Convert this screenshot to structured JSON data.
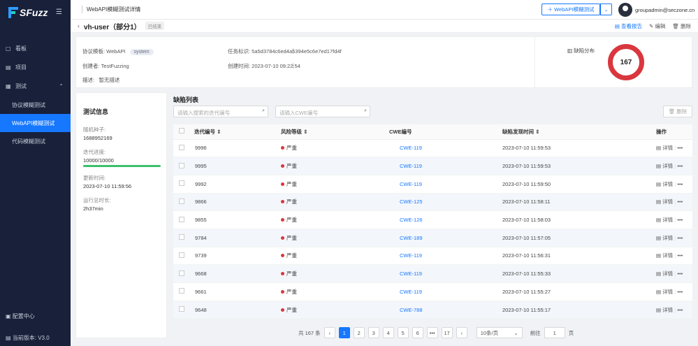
{
  "app": {
    "logo": "SFuzz"
  },
  "sidebar": {
    "items": [
      {
        "label": "看板",
        "icon": "dashboard-icon"
      },
      {
        "label": "项目",
        "icon": "project-icon"
      }
    ],
    "group": {
      "label": "测试",
      "icon": "test-icon"
    },
    "subs": [
      {
        "label": "协议模糊测试"
      },
      {
        "label": "WebAPI模糊测试",
        "active": true
      },
      {
        "label": "代码模糊测试"
      }
    ],
    "config": "配置中心",
    "version": "当前版本: V3.0"
  },
  "topbar": {
    "title": "WebAPI模糊测试详情",
    "new_btn": "WebAPI模糊测试",
    "user": "groupadmin@seczone.cn"
  },
  "header": {
    "title": "vh-user（部分1）",
    "status": "已结束",
    "view_report": "查看报告",
    "edit": "编辑",
    "delete": "删除"
  },
  "info": {
    "template_label": "协议模板: WebAPI",
    "template_tag": "system",
    "creator": "创建者: TestFuzzing",
    "desc_label": "描述:",
    "desc_value": "暂无描述",
    "task_id": "任务标识: 5a5d3784c6ed4a5394e5c6e7ed17fd4f",
    "create_time": "创建时间: 2023-07-10 09:22:54",
    "dist_title": "缺陷分布",
    "dist_total": "167"
  },
  "testinfo": {
    "title": "测试信息",
    "seed_label": "随机种子:",
    "seed": "1688952169",
    "progress_label": "迭代进度:",
    "progress": "10000/10000",
    "progress_fraction": 1.0,
    "update_label": "更新时间:",
    "update": "2023-07-10 11:59:56",
    "runtime_label": "运行总时长:",
    "runtime": "2h37min"
  },
  "list": {
    "title": "缺陷列表",
    "search1": "请输入搜索的迭代编号",
    "search2": "请输入CWE编号",
    "delete": "删除",
    "headers": [
      "迭代编号",
      "风险等级",
      "CWE编号",
      "缺陷发现时间",
      "操作"
    ],
    "detail": "详情",
    "rows": [
      {
        "id": "9996",
        "risk": "严重",
        "cwe": "CWE-119",
        "time": "2023-07-10 11:59:53"
      },
      {
        "id": "9995",
        "risk": "严重",
        "cwe": "CWE-119",
        "time": "2023-07-10 11:59:53"
      },
      {
        "id": "9992",
        "risk": "严重",
        "cwe": "CWE-119",
        "time": "2023-07-10 11:59:50"
      },
      {
        "id": "9866",
        "risk": "严重",
        "cwe": "CWE-125",
        "time": "2023-07-10 11:58:11"
      },
      {
        "id": "9855",
        "risk": "严重",
        "cwe": "CWE-126",
        "time": "2023-07-10 11:58:03"
      },
      {
        "id": "9784",
        "risk": "严重",
        "cwe": "CWE-189",
        "time": "2023-07-10 11:57:05"
      },
      {
        "id": "9739",
        "risk": "严重",
        "cwe": "CWE-119",
        "time": "2023-07-10 11:56:31"
      },
      {
        "id": "9668",
        "risk": "严重",
        "cwe": "CWE-119",
        "time": "2023-07-10 11:55:33"
      },
      {
        "id": "9661",
        "risk": "严重",
        "cwe": "CWE-119",
        "time": "2023-07-10 11:55:27"
      },
      {
        "id": "9648",
        "risk": "严重",
        "cwe": "CWE-788",
        "time": "2023-07-10 11:55:17"
      }
    ]
  },
  "pager": {
    "total": "共 167 条",
    "pages": [
      "1",
      "2",
      "3",
      "4",
      "5",
      "6",
      "•••",
      "17"
    ],
    "current": "1",
    "size": "10条/页",
    "goto": "前往",
    "goto_value": "1",
    "page_unit": "页"
  },
  "colors": {
    "accent": "#1677ff",
    "sidebar": "#18203a",
    "danger": "#d9363e",
    "progress": "#3cc06a"
  }
}
